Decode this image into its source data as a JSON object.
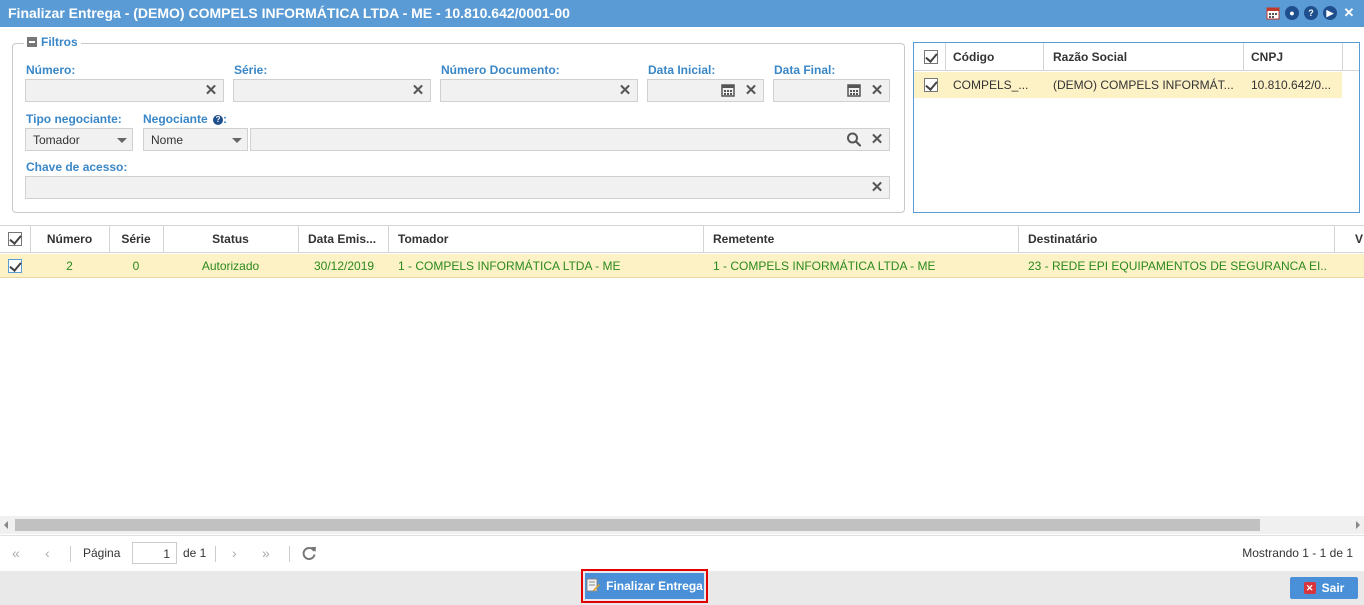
{
  "window": {
    "title": "Finalizar Entrega - (DEMO) COMPELS INFORMÁTICA LTDA - ME - 10.810.642/0001-00"
  },
  "filters": {
    "legend": "Filtros",
    "numero_label": "Número:",
    "serie_label": "Série:",
    "numero_documento_label": "Número Documento:",
    "data_inicial_label": "Data Inicial:",
    "data_final_label": "Data Final:",
    "tipo_negociante_label": "Tipo negociante:",
    "tipo_negociante_value": "Tomador",
    "negociante_label": "Negociante",
    "negociante_mode": "Nome",
    "chave_acesso_label": "Chave de acesso:"
  },
  "company_grid": {
    "headers": [
      "Código",
      "Razão Social",
      "CNPJ"
    ],
    "rows": [
      {
        "codigo": "COMPELS_...",
        "razao_social": "(DEMO) COMPELS INFORMÁT...",
        "cnpj": "10.810.642/0..."
      }
    ]
  },
  "main_grid": {
    "headers": [
      "Número",
      "Série",
      "Status",
      "Data Emis...",
      "Tomador",
      "Remetente",
      "Destinatário",
      "V"
    ],
    "rows": [
      {
        "numero": "2",
        "serie": "0",
        "status": "Autorizado",
        "data_emissao": "30/12/2019",
        "tomador": "1 - COMPELS INFORMÁTICA LTDA - ME",
        "remetente": "1 - COMPELS INFORMÁTICA LTDA - ME",
        "destinatario": "23 - REDE EPI EQUIPAMENTOS DE SEGURANCA EI..."
      }
    ]
  },
  "pager": {
    "page_label": "Página",
    "page_value": "1",
    "of_label": "de 1",
    "showing": "Mostrando 1 - 1 de 1"
  },
  "footer": {
    "finalizar_label": "Finalizar Entrega",
    "sair_label": "Sair"
  },
  "colors": {
    "titlebar": "#5a9bd5",
    "label_blue": "#3a87c8",
    "row_highlight": "#fdf1c6",
    "status_green": "#2a8a1c",
    "button_blue": "#4a90d9",
    "focus_red": "#e00000"
  },
  "icons": {
    "titlebar": [
      "calendar-icon",
      "settings-icon",
      "help-icon",
      "play-icon",
      "close-icon"
    ]
  }
}
